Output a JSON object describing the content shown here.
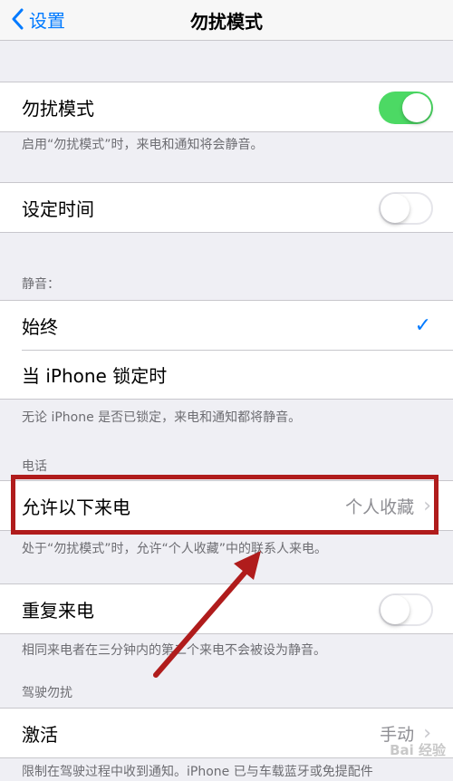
{
  "nav": {
    "back_label": "设置",
    "title": "勿扰模式"
  },
  "dnd": {
    "label": "勿扰模式",
    "enabled": true,
    "note": "启用“勿扰模式”时，来电和通知将会静音。"
  },
  "scheduled": {
    "label": "设定时间",
    "enabled": false
  },
  "silence": {
    "header": "静音：",
    "options": [
      {
        "label": "始终",
        "selected": true
      },
      {
        "label": "当 iPhone 锁定时",
        "selected": false
      }
    ],
    "note": "无论 iPhone 是否已锁定，来电和通知都将静音。"
  },
  "phone": {
    "header": "电话",
    "allow_calls": {
      "label": "允许以下来电",
      "value": "个人收藏"
    },
    "allow_note": "处于“勿扰模式”时，允许“个人收藏”中的联系人来电。",
    "repeated": {
      "label": "重复来电",
      "enabled": false
    },
    "repeated_note": "相同来电者在三分钟内的第二个来电不会被设为静音。"
  },
  "driving": {
    "header": "驾驶勿扰",
    "activate": {
      "label": "激活",
      "value": "手动"
    },
    "note": "限制在驾驶过程中收到通知。iPhone 已与车载蓝牙或免提配件"
  },
  "watermark": "Bai 经验",
  "colors": {
    "accent": "#007aff",
    "toggle_on": "#4cd964",
    "highlight": "#b01c1c"
  }
}
